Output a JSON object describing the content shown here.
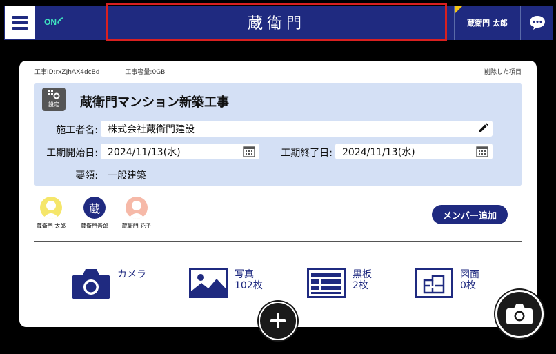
{
  "header": {
    "status": "ON",
    "logo": "蔵衛門",
    "user_name": "蔵衛門 太郎"
  },
  "project": {
    "id_text": "工事ID:rxZJhAX4dcBd",
    "capacity_text": "工事容量:0GB",
    "deleted_link": "削除した項目",
    "settings_label": "設定",
    "title": "蔵衛門マンション新築工事",
    "contractor_label": "施工者名:",
    "contractor_value": "株式会社蔵衛門建設",
    "start_label": "工期開始日:",
    "start_value": "2024/11/13(水)",
    "end_label": "工期終了日:",
    "end_value": "2024/11/13(水)",
    "summary_label": "要領:",
    "summary_value": "一般建築"
  },
  "members": [
    {
      "name": "蔵衛門 太郎",
      "avatar_color": "#f5e66a"
    },
    {
      "name": "蔵衛門吾郎",
      "avatar_color": "#1f2a80",
      "avatar_glyph": "蔵"
    },
    {
      "name": "蔵衛門 花子",
      "avatar_color": "#f6b9a8"
    }
  ],
  "add_member_label": "メンバー追加",
  "actions": [
    {
      "icon": "camera-icon",
      "line1": "カメラ",
      "line2": ""
    },
    {
      "icon": "photo-icon",
      "line1": "写真",
      "line2": "102枚"
    },
    {
      "icon": "blackboard-icon",
      "line1": "黒板",
      "line2": "2枚"
    },
    {
      "icon": "floorplan-icon",
      "line1": "図面",
      "line2": "0枚"
    }
  ],
  "colors": {
    "brand": "#1f2a80",
    "panel": "#d4e0f5",
    "status_on": "#3fe3c0",
    "highlight_border": "#d92020"
  }
}
